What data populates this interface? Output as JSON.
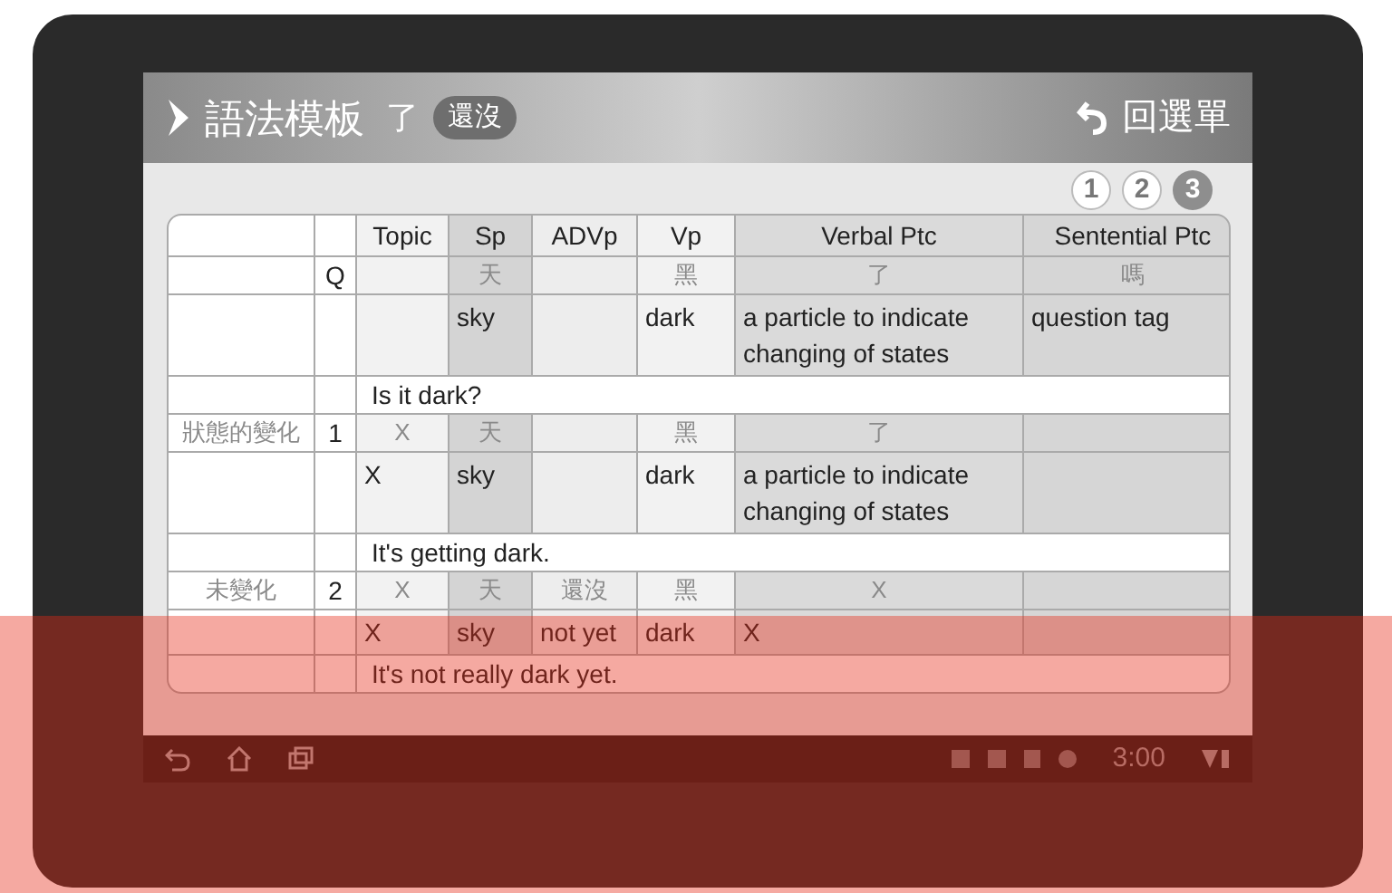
{
  "header": {
    "title": "語法模板",
    "particle": "了",
    "badge": "還沒",
    "back_button": "回選單"
  },
  "pages": [
    {
      "label": "1",
      "selected": false
    },
    {
      "label": "2",
      "selected": false
    },
    {
      "label": "3",
      "selected": true
    }
  ],
  "table": {
    "columns": [
      "Topic",
      "Sp",
      "ADVp",
      "Vp",
      "Verbal Ptc",
      "Sentential Ptc"
    ],
    "groups": [
      {
        "number": "Q",
        "words": {
          "sp": "天",
          "vp": "黑",
          "verbal_ptc": "了",
          "sentential_ptc": "嗎"
        },
        "gloss": {
          "sp": "sky",
          "vp": "dark",
          "verbal_ptc": "a particle to indicate changing of states",
          "sentential_ptc": "question tag"
        },
        "translation": "Is it dark?"
      },
      {
        "label": "狀態的變化",
        "number": "1",
        "words": {
          "topic": "X",
          "sp": "天",
          "vp": "黑",
          "verbal_ptc": "了"
        },
        "gloss": {
          "topic": "X",
          "sp": "sky",
          "vp": "dark",
          "verbal_ptc": "a particle to indicate changing of states"
        },
        "translation": "It's getting dark."
      },
      {
        "label": "未變化",
        "number": "2",
        "words": {
          "topic": "X",
          "sp": "天",
          "advp": "還沒",
          "vp": "黑",
          "verbal_ptc": "X"
        },
        "gloss": {
          "topic": "X",
          "sp": "sky",
          "advp": "not yet",
          "vp": "dark",
          "verbal_ptc": "X"
        },
        "translation": "It's not really dark yet."
      }
    ]
  },
  "status_bar": {
    "time": "3:00"
  }
}
